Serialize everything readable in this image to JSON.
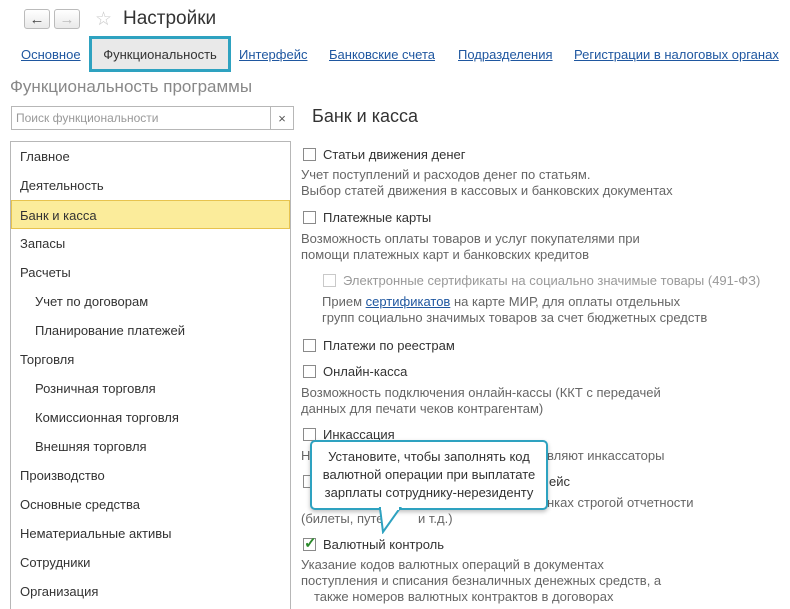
{
  "header": {
    "title": "Настройки",
    "back_icon": "←",
    "forward_icon": "→",
    "star_icon": "☆"
  },
  "tabs": [
    {
      "label": "Основное"
    },
    {
      "label": "Функциональность"
    },
    {
      "label": "Интерфейс"
    },
    {
      "label": "Банковские счета"
    },
    {
      "label": "Подразделения"
    },
    {
      "label": "Регистрации в налоговых органах"
    }
  ],
  "section_title": "Функциональность программы",
  "search": {
    "placeholder": "Поиск функциональности",
    "value": "",
    "clear_icon": "×"
  },
  "sidebar": {
    "items": [
      {
        "label": "Главное"
      },
      {
        "label": "Деятельность"
      },
      {
        "label": "Банк и касса"
      },
      {
        "label": "Запасы"
      },
      {
        "label": "Расчеты"
      },
      {
        "label": "Учет по договорам"
      },
      {
        "label": "Планирование платежей"
      },
      {
        "label": "Торговля"
      },
      {
        "label": "Розничная торговля"
      },
      {
        "label": "Комиссионная торговля"
      },
      {
        "label": "Внешняя торговля"
      },
      {
        "label": "Производство"
      },
      {
        "label": "Основные средства"
      },
      {
        "label": "Нематериальные активы"
      },
      {
        "label": "Сотрудники"
      },
      {
        "label": "Организация"
      }
    ]
  },
  "main": {
    "heading": "Банк и касса",
    "options": [
      {
        "label": "Статьи движения денег",
        "checked": false,
        "desc": [
          "Учет поступлений и расходов денег по статьям.",
          "Выбор статей движения в кассовых и банковских документах"
        ]
      },
      {
        "label": "Платежные карты",
        "checked": false,
        "desc": [
          "Возможность оплаты товаров и услуг покупателями при",
          "помощи платежных карт и банковских кредитов"
        ]
      },
      {
        "label": "Электронные сертификаты на социально значимые товары (491-ФЗ)",
        "checked": false,
        "disabled": true,
        "desc_pre": "Прием ",
        "desc_link": "сертификатов",
        "desc_post": " на карте МИР, для оплаты отдельных",
        "desc2": "групп социально значимых товаров за счет бюджетных средств"
      },
      {
        "label": "Платежи по реестрам",
        "checked": false
      },
      {
        "label": "Онлайн-касса",
        "checked": false,
        "desc": [
          "Возможность подключения онлайн-кассы (ККТ с передачей",
          "данных для печати чеков контрагентам)"
        ]
      },
      {
        "label": "Инкассация",
        "checked": false,
        "desc_left": "Н",
        "desc_right": "вляют инкассаторы"
      },
      {
        "label_right": "ейс",
        "checked": false,
        "desc_right": "нках строгой отчетности",
        "desc2_left": "(билеты, путев",
        "desc2_right": "и т.д.)"
      },
      {
        "label": "Валютный контроль",
        "checked": true,
        "desc": [
          "Указание кодов валютных операций в документах",
          "поступления и списания безналичных денежных средств, а",
          "также номеров валютных контрактов в договорах"
        ]
      }
    ]
  },
  "callout": {
    "lines": [
      "Установите, чтобы заполнять код",
      "валютной операции при выплатате",
      "зарплаты сотруднику-нерезиденту"
    ]
  },
  "colors": {
    "accent": "#2ea2c0",
    "link": "#1f57a0",
    "selection": "#fbec9b",
    "check": "#2c8a2c"
  }
}
